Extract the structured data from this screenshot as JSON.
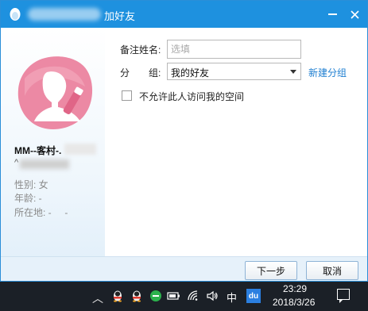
{
  "title": {
    "text": "加好友",
    "minimize_icon": "minimize-icon",
    "close_icon": "close-icon",
    "app_icon": "qq-penguin-icon"
  },
  "profile": {
    "nickname": "MM--客村-.",
    "account_prefix": "^",
    "gender": "性别: 女",
    "age": "年龄: -",
    "location": "所在地: -     -"
  },
  "form": {
    "remark_label": "备注姓名:",
    "remark_placeholder": "选填",
    "remark_value": "",
    "group_label_left": "分",
    "group_label_right": "组:",
    "group_selected": "我的好友",
    "new_group_link": "新建分组",
    "block_space_label": "不允许此人访问我的空间",
    "block_space_checked": false
  },
  "footer": {
    "next_button": "下一步",
    "cancel_button": "取消"
  },
  "taskbar": {
    "ime": "中",
    "baidu_badge": "du",
    "time": "23:29",
    "date": "2018/3/26"
  },
  "colors": {
    "titlebar": "#1e91df",
    "link": "#1f7fd1",
    "avatar_pink": "#ec89a4"
  }
}
